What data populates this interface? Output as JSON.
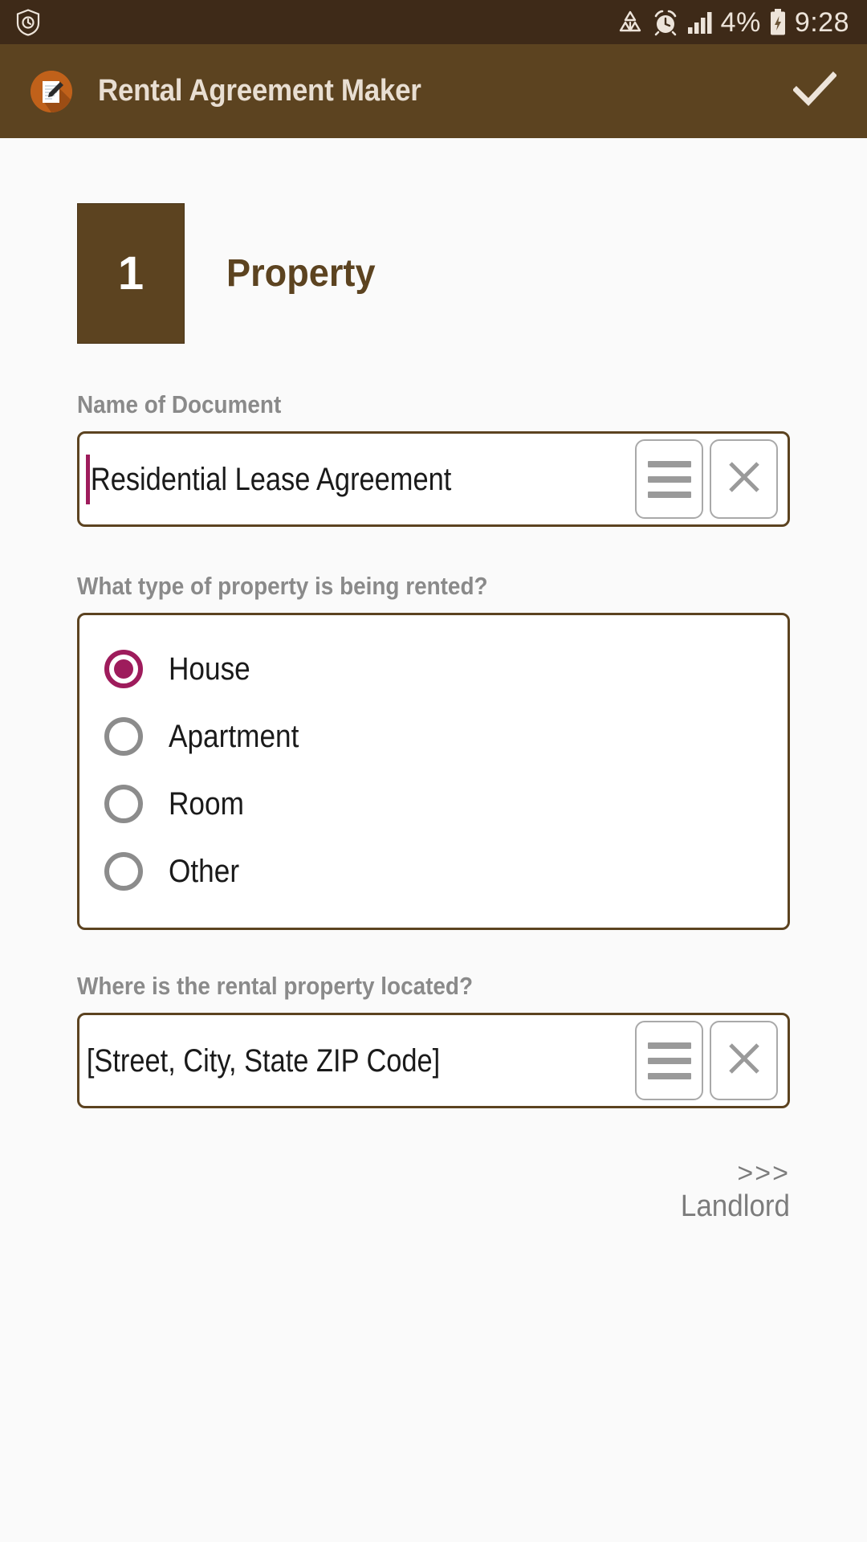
{
  "status_bar": {
    "left_icon": "shield-clock-icon",
    "icons": [
      "data-saver-icon",
      "alarm-clock-icon",
      "signal-bars-icon"
    ],
    "battery_percent": "4%",
    "battery_icon": "battery-charging-icon",
    "time": "9:28",
    "background": "#3E2A18",
    "foreground": "#EDE4DA"
  },
  "app_bar": {
    "icon": "app-document-pen-icon",
    "title": "Rental Agreement Maker",
    "action_icon": "check-icon",
    "background": "#5C4320",
    "title_color": "#E8DED2"
  },
  "step": {
    "number": "1",
    "title": "Property",
    "badge_color": "#5C4320",
    "title_color": "#5C4320"
  },
  "fields": {
    "document_name": {
      "label": "Name of Document",
      "value": "Residential Lease Agreement",
      "has_caret": true,
      "caret_color": "#9E1C5C",
      "menu_icon": "hamburger-icon",
      "clear_icon": "close-icon"
    },
    "property_type": {
      "label": "What type of property is being rented?",
      "options": [
        {
          "label": "House",
          "selected": true
        },
        {
          "label": "Apartment",
          "selected": false
        },
        {
          "label": "Room",
          "selected": false
        },
        {
          "label": "Other",
          "selected": false
        }
      ],
      "selected_color": "#9E1C5C",
      "unselected_color": "#8C8C8C"
    },
    "location": {
      "label": "Where is the rental property located?",
      "value": "[Street, City, State ZIP Code]",
      "has_caret": false,
      "menu_icon": "hamburger-icon",
      "clear_icon": "close-icon"
    }
  },
  "next_nav": {
    "arrows": ">>>",
    "label": "Landlord",
    "color": "#7C7C7C"
  },
  "theme": {
    "page_background": "#FAFAFA",
    "field_border": "#5C4320",
    "label_color": "#8A8A8A"
  }
}
